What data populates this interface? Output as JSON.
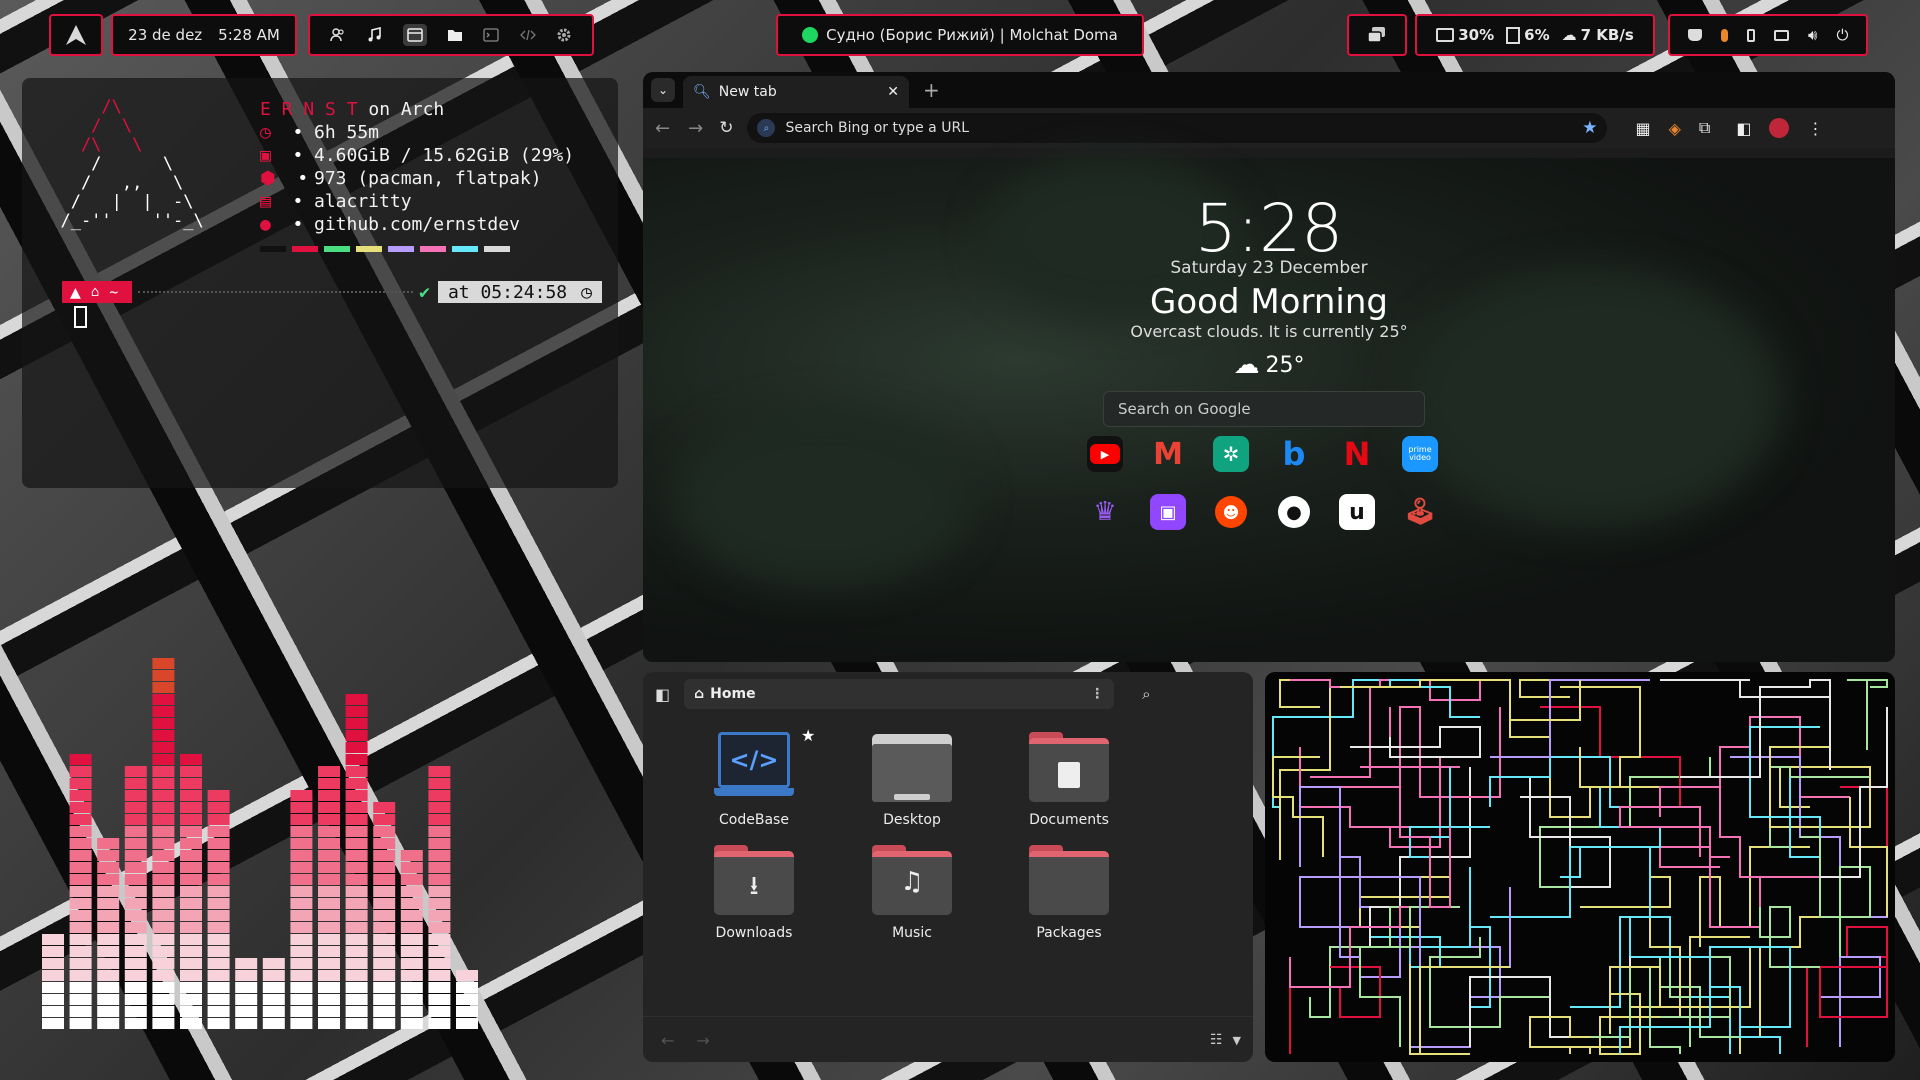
{
  "topbar": {
    "date": "23 de dez",
    "time": "5:28 AM",
    "now_playing": "Судно (Борис Рижий) | Molchat Doma",
    "cpu": "30%",
    "mem": "6%",
    "net": "7 KB/s",
    "app_icons": [
      "users-icon",
      "music-icon",
      "browser-icon",
      "folder-icon",
      "terminal-icon",
      "code-icon",
      "settings-icon"
    ],
    "sys_icons": [
      "mug-icon",
      "mic-icon",
      "phone-icon",
      "display-icon",
      "volume-icon",
      "power-icon"
    ]
  },
  "terminal": {
    "title_name": "E R N S T",
    "title_rest": " on Arch",
    "uptime": "6h 55m",
    "memory": "4.60GiB / 15.62GiB (29%)",
    "packages": "973 (pacman, flatpak)",
    "term": "alacritty",
    "github": "github.com/ernstdev",
    "prompt_dir": "~",
    "prompt_check": "✔",
    "prompt_time": "at 05:24:58",
    "palette": [
      "#111111",
      "#e0113f",
      "#4ade80",
      "#e5e07a",
      "#b79cff",
      "#f472b6",
      "#67e8f9",
      "#d9d9d9"
    ]
  },
  "browser": {
    "tab_title": "New tab",
    "url_placeholder": "Search Bing or type a URL",
    "clock": "5:28",
    "date": "Saturday 23 December",
    "greeting": "Good Morning",
    "weather_text": "Overcast clouds. It is currently 25°",
    "temp": "25°",
    "search_placeholder": "Search on Google",
    "shortcuts_row1": [
      "youtube",
      "gmail",
      "chatgpt",
      "bing",
      "netflix",
      "prime video"
    ],
    "shortcuts_row2": [
      "crown",
      "twitch",
      "reddit",
      "github",
      "u",
      "joystick"
    ],
    "prime_label": "prime video"
  },
  "files": {
    "path": "Home",
    "folders": [
      "CodeBase",
      "Desktop",
      "Documents",
      "Downloads",
      "Music",
      "Packages"
    ]
  },
  "visualizer": {
    "levels": [
      0.25,
      0.73,
      0.53,
      0.72,
      1.0,
      0.75,
      0.64,
      0.18,
      0.18,
      0.63,
      0.72,
      0.91,
      0.61,
      0.49,
      0.71,
      0.17
    ]
  }
}
